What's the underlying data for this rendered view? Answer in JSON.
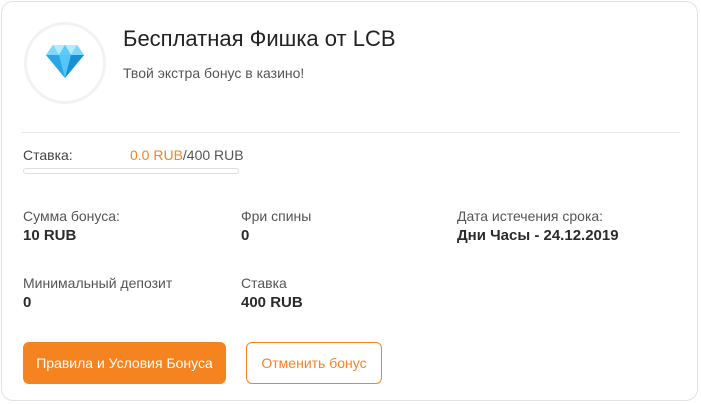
{
  "header": {
    "icon": "diamond-icon",
    "title": "Бесплатная Фишка от LCB",
    "subtitle": "Твой экстра бонус в казино!"
  },
  "wager": {
    "label": "Ставка:",
    "current": "0.0 RUB",
    "total": "/400 RUB",
    "progress_fraction": 0
  },
  "info": {
    "bonus_amount": {
      "label": "Сумма бонуса:",
      "value": "10 RUB"
    },
    "free_spins": {
      "label": "Фри спины",
      "value": "0"
    },
    "expiry": {
      "label": "Дата истечения срока:",
      "value": "Дни Часы - 24.12.2019"
    },
    "min_deposit": {
      "label": "Минимальный депозит",
      "value": "0"
    },
    "bet": {
      "label": "Ставка",
      "value": "400 RUB"
    }
  },
  "buttons": {
    "terms": "Правила и Условия Бонуса",
    "cancel": "Отменить бонус"
  },
  "colors": {
    "accent": "#f5831f",
    "diamond_light": "#8fe3ff",
    "diamond_dark": "#1aa0e6"
  }
}
